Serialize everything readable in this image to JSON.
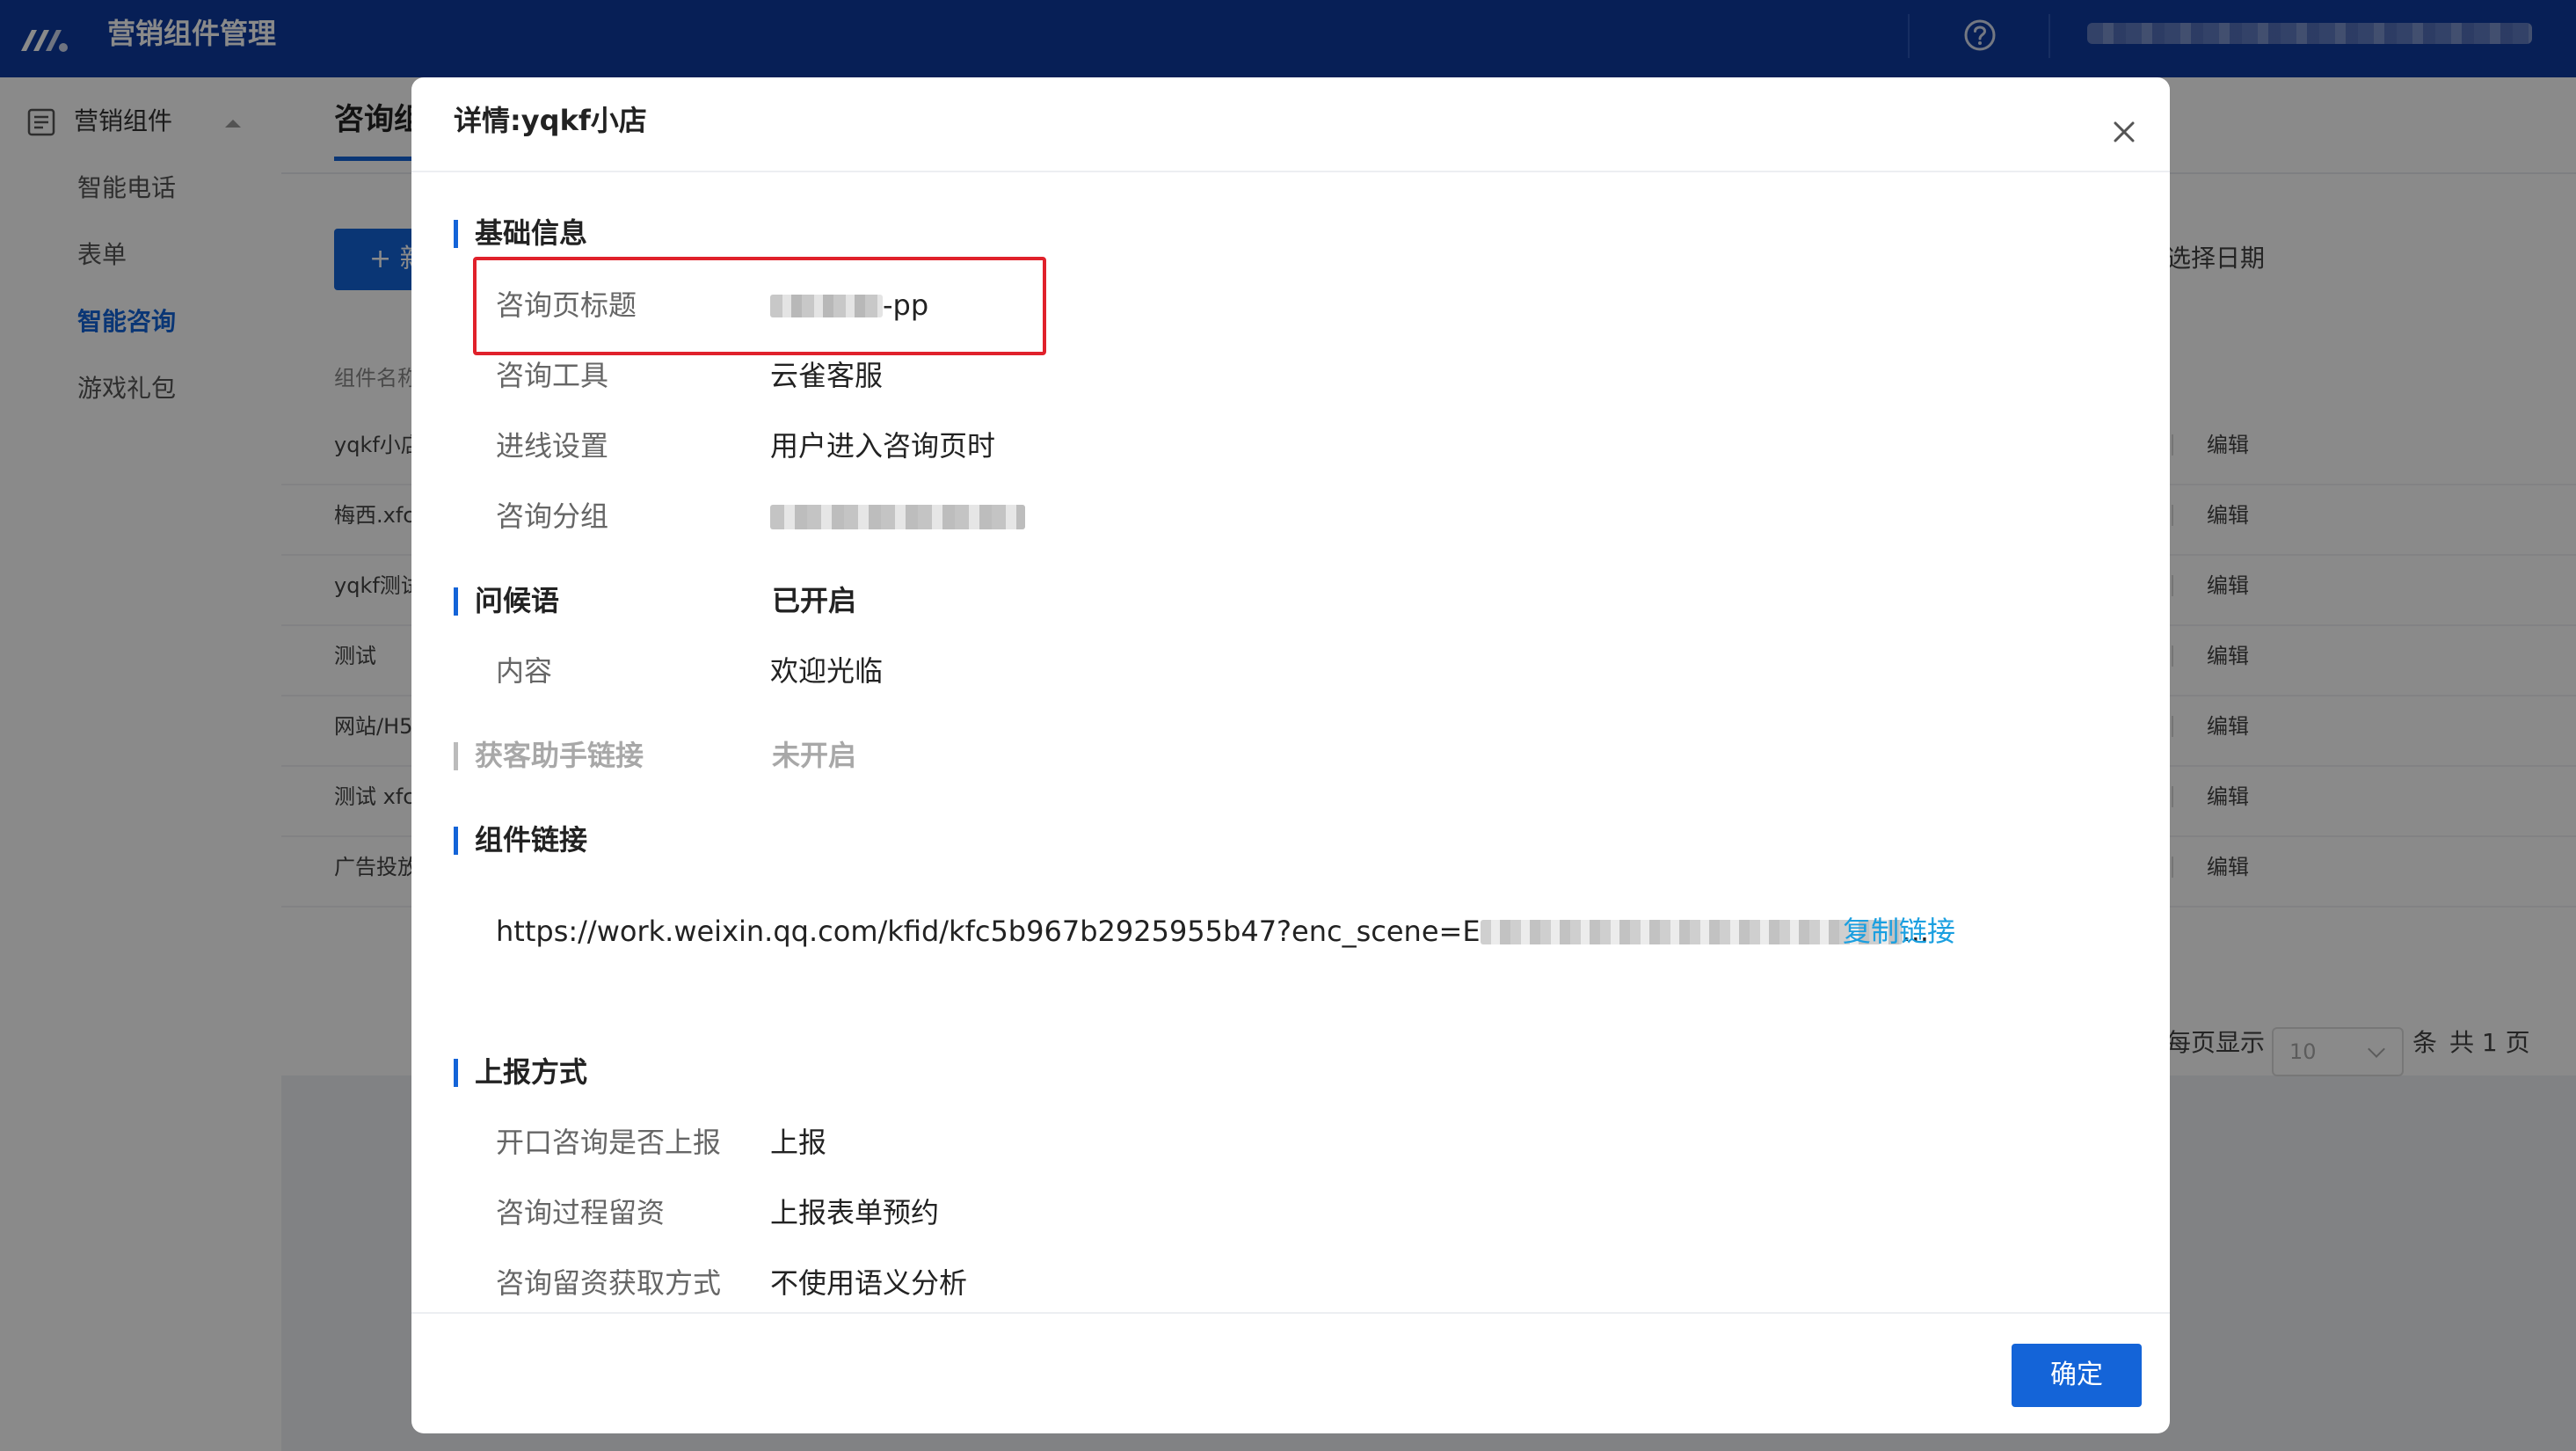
{
  "header": {
    "app_title": "营销组件管理",
    "icons": {
      "logo": "brand-logo-icon",
      "help": "help-circle-icon"
    }
  },
  "sidebar": {
    "section_label": "营销组件",
    "items": [
      {
        "label": "智能电话",
        "active": false
      },
      {
        "label": "表单",
        "active": false
      },
      {
        "label": "智能咨询",
        "active": true
      },
      {
        "label": "游戏礼包",
        "active": false
      }
    ]
  },
  "background_page": {
    "title_partial": "咨询组",
    "add_button_label": "+ 新",
    "date_picker": "选择日期",
    "column_header_partial": "组件名称",
    "rows": [
      {
        "name": "yqkf小店",
        "action": "编辑"
      },
      {
        "name": "梅西.xfc",
        "action": "编辑"
      },
      {
        "name": "yqkf测试",
        "action": "编辑"
      },
      {
        "name": "测试",
        "action": "编辑"
      },
      {
        "name": "网站/H5",
        "action": "编辑"
      },
      {
        "name": "测试 xfc",
        "action": "编辑"
      },
      {
        "name": "广告投放",
        "action": "编辑"
      }
    ],
    "pagination": {
      "per_page_label": "每页显示",
      "per_page_value": "10",
      "unit": "条",
      "total": "共 1 页"
    }
  },
  "modal": {
    "title": "详情:yqkf小店",
    "sections": {
      "basic": {
        "title": "基础信息",
        "fields": [
          {
            "label": "咨询页标题",
            "value_suffix": "-pp"
          },
          {
            "label": "咨询工具",
            "value": "云雀客服"
          },
          {
            "label": "进线设置",
            "value": "用户进入咨询页时"
          },
          {
            "label": "咨询分组",
            "value": ""
          }
        ]
      },
      "greeting": {
        "title": "问候语",
        "status": "已开启",
        "content_label": "内容",
        "content_value": "欢迎光临"
      },
      "assistant": {
        "title": "获客助手链接",
        "status": "未开启"
      },
      "link": {
        "title": "组件链接",
        "url_visible": "https://work.weixin.qq.com/kfid/kfc5b967b2925955b47?enc_scene=E",
        "url_tail": "...",
        "copy_label": "复制链接"
      },
      "report": {
        "title": "上报方式",
        "fields": [
          {
            "label": "开口咨询是否上报",
            "value": "上报"
          },
          {
            "label": "咨询过程留资",
            "value": "上报表单预约"
          },
          {
            "label": "咨询留资获取方式",
            "value": "不使用语义分析"
          }
        ]
      }
    },
    "confirm_label": "确定",
    "highlight_color": "#e0212b"
  },
  "colors": {
    "primary": "#1464d8",
    "header_bg": "#0d3aa0",
    "link": "#1a9fe0"
  }
}
